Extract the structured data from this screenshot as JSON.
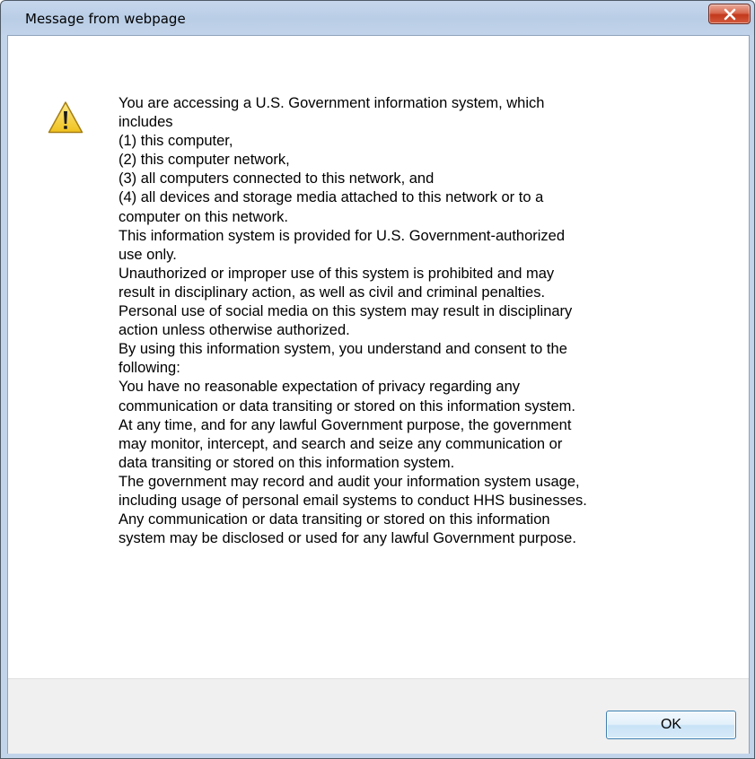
{
  "window": {
    "title": "Message from webpage",
    "close_icon": "close-x-icon"
  },
  "dialog": {
    "icon": "warning-triangle-icon",
    "message_lines": [
      "You are accessing a U.S. Government information system, which",
      "includes",
      "(1) this computer,",
      "(2) this computer network,",
      "(3) all computers connected to this network, and",
      "(4) all devices and storage media attached to this network or to a",
      "computer on this network.",
      "This information system is provided for U.S. Government-authorized",
      "use only.",
      "Unauthorized or improper use of this system is prohibited and may",
      "result in disciplinary action, as well as civil and criminal penalties.",
      "Personal use of social media on this system may result in disciplinary",
      "action unless otherwise authorized.",
      "By using this information system, you understand and consent to the",
      "following:",
      "You have no reasonable expectation of privacy regarding any",
      "communication or data transiting or stored on this information system.",
      " At any time, and for any lawful Government purpose, the government",
      "may monitor, intercept, and search and seize any communication or",
      "data transiting or stored on this information system.",
      "The government may record and audit your information system usage,",
      "including usage of personal email systems to conduct HHS businesses.",
      "Any communication or data transiting or stored on this information",
      "system may be disclosed or used for any lawful Government purpose."
    ],
    "ok_label": "OK"
  },
  "colors": {
    "frame": "#c2d4ea",
    "close_button": "#c7432a",
    "footer": "#f0f0f0",
    "ok_border": "#3c7fb1",
    "warning_yellow": "#f6d33c"
  }
}
